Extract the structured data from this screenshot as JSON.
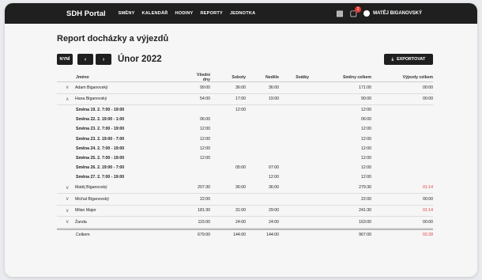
{
  "app": {
    "title": "SDH Portal"
  },
  "nav": [
    "SMĚNY",
    "KALENDÁŘ",
    "HODINY",
    "REPORTY",
    "JEDNOTKA"
  ],
  "header": {
    "notifications": "2",
    "user": "MATĚJ BIGANOVSKÝ"
  },
  "page": {
    "title": "Report docházky a výjezdů"
  },
  "toolbar": {
    "now": "NYNÍ",
    "prev": "‹",
    "next": "›",
    "month": "Únor 2022",
    "export": "EXPORTOVAT"
  },
  "table": {
    "columns": [
      "Jméno",
      "Všední dny",
      "Soboty",
      "Neděle",
      "Svátky",
      "Směny celkem",
      "Výjezdy celkem"
    ],
    "rows": [
      {
        "type": "main",
        "expanded": false,
        "cells": [
          "Adam Biganovský",
          "99:00",
          "36:00",
          "36:00",
          "",
          "171:00",
          "00:00"
        ],
        "red": false
      },
      {
        "type": "main",
        "expanded": true,
        "cells": [
          "Hana Biganovský",
          "54:00",
          "17:00",
          "19:00",
          "",
          "90:00",
          "00:00"
        ],
        "red": false
      },
      {
        "type": "sub",
        "cells": [
          "Směna 19. 2. 7:00 - 19:00",
          "",
          "12:00",
          "",
          "",
          "12:00",
          ""
        ]
      },
      {
        "type": "sub",
        "cells": [
          "Směna 22. 2. 19:00 - 1:00",
          "06:00",
          "",
          "",
          "",
          "06:00",
          ""
        ]
      },
      {
        "type": "sub",
        "cells": [
          "Směna 23. 2. 7:00 - 19:00",
          "12:00",
          "",
          "",
          "",
          "12:00",
          ""
        ]
      },
      {
        "type": "sub",
        "cells": [
          "Směna 23. 2. 19:00 - 7:00",
          "12:00",
          "",
          "",
          "",
          "12:00",
          ""
        ]
      },
      {
        "type": "sub",
        "cells": [
          "Směna 24. 2. 7:00 - 19:00",
          "12:00",
          "",
          "",
          "",
          "12:00",
          ""
        ]
      },
      {
        "type": "sub",
        "cells": [
          "Směna 25. 2. 7:00 - 19:00",
          "12:00",
          "",
          "",
          "",
          "12:00",
          ""
        ]
      },
      {
        "type": "sub",
        "cells": [
          "Směna 26. 2. 19:00 - 7:00",
          "",
          "05:00",
          "07:00",
          "",
          "12:00",
          ""
        ]
      },
      {
        "type": "sub",
        "cells": [
          "Směna 27. 2. 7:00 - 19:00",
          "",
          "",
          "12:00",
          "",
          "12:00",
          ""
        ]
      },
      {
        "type": "main",
        "expanded": false,
        "cells": [
          "Matěj Biganovský",
          "207:30",
          "36:00",
          "36:00",
          "",
          "279:30",
          "01:14"
        ],
        "red": true
      },
      {
        "type": "main",
        "expanded": false,
        "cells": [
          "Michal Biganovský",
          "22:00",
          "",
          "",
          "",
          "22:00",
          "00:00"
        ],
        "red": false
      },
      {
        "type": "main",
        "expanded": false,
        "cells": [
          "Milan Majer",
          "181:30",
          "31:00",
          "29:00",
          "",
          "241:30",
          "01:14"
        ],
        "red": true
      },
      {
        "type": "main",
        "expanded": false,
        "cells": [
          "Žanda",
          "115:00",
          "24:00",
          "24:00",
          "",
          "163:00",
          "00:00"
        ],
        "red": false
      },
      {
        "type": "total",
        "cells": [
          "Celkem",
          "679:00",
          "144:00",
          "144:00",
          "",
          "967:00",
          "02:28"
        ],
        "red": true
      }
    ]
  },
  "colors": {
    "accent": "#1f1f1f",
    "danger": "#e53935"
  }
}
